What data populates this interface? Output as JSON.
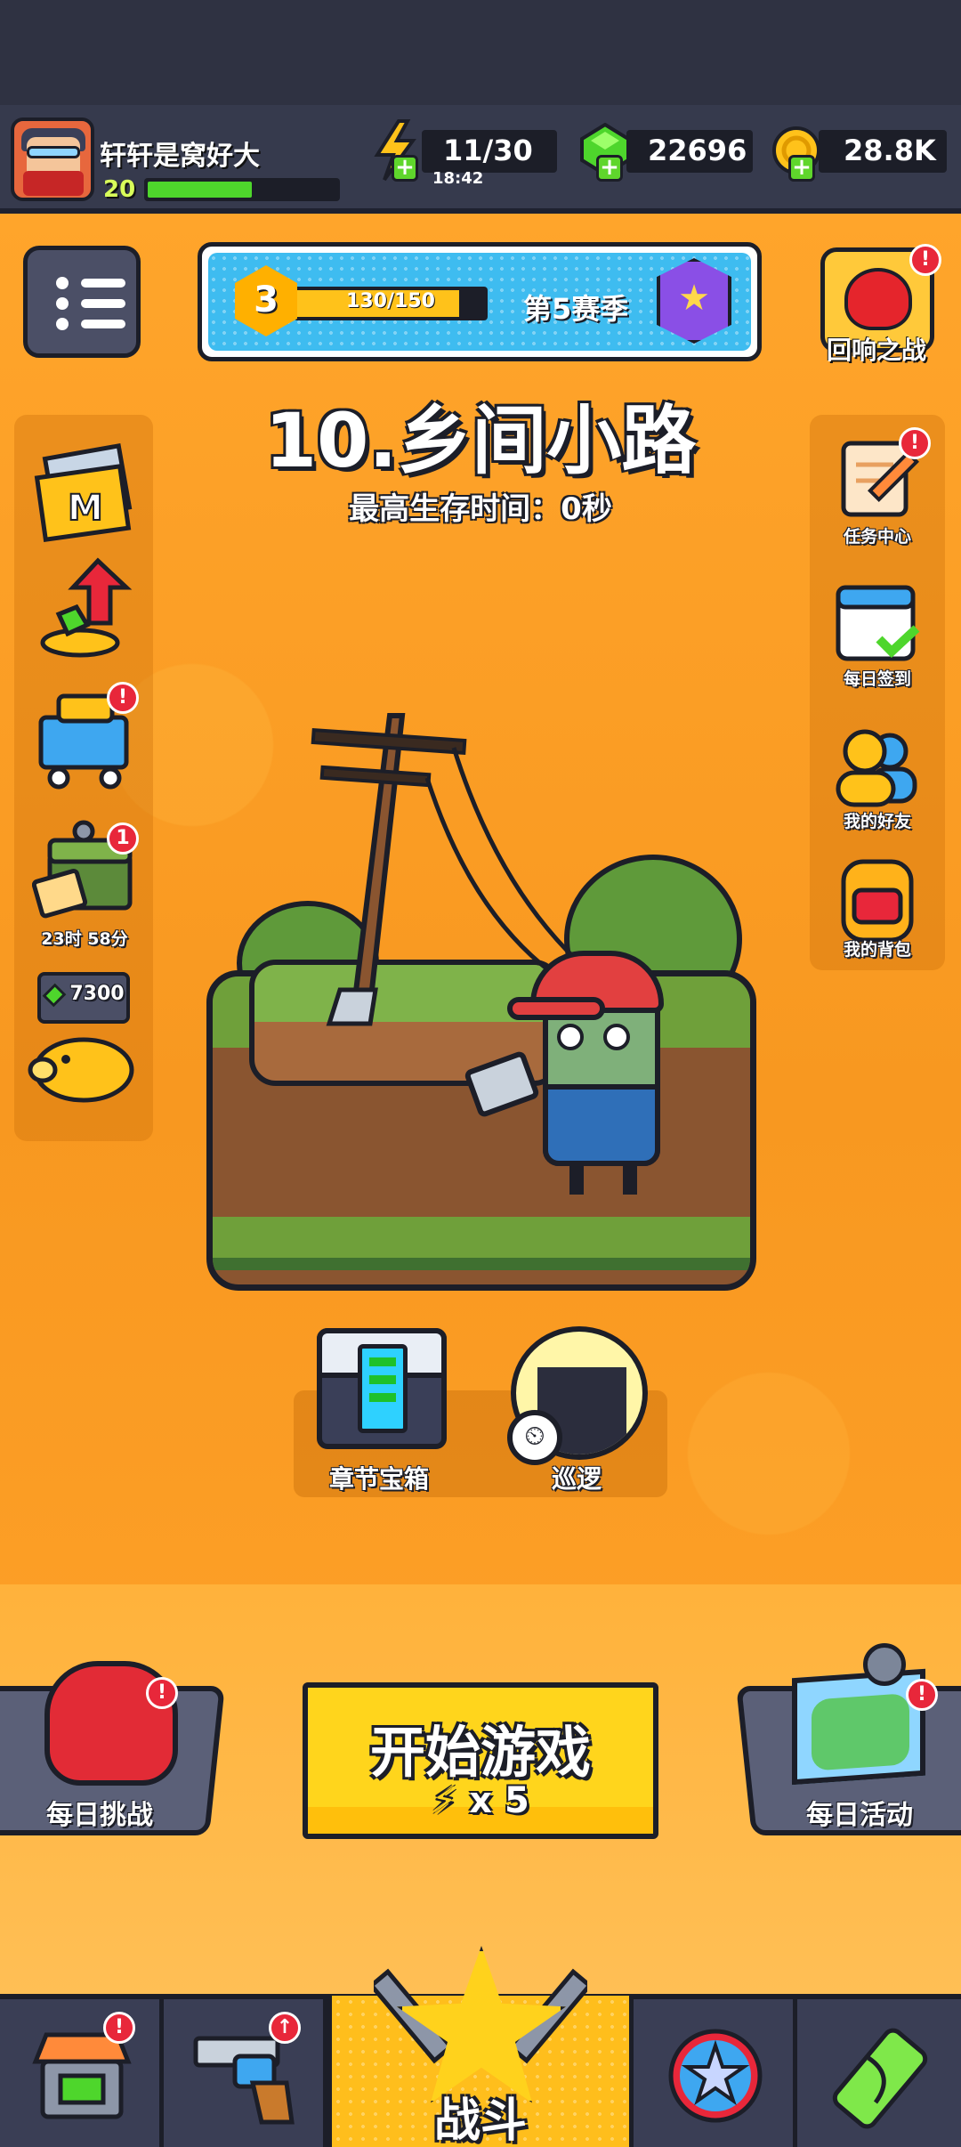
{
  "player": {
    "name": "轩轩是窝好大",
    "level": "20",
    "xp_fraction": 0.55
  },
  "resources": {
    "energy": "11/30",
    "energy_timer": "18:42",
    "gems": "22696",
    "coins": "28.8K"
  },
  "season": {
    "level": "3",
    "progress_text": "130/150",
    "progress_fraction": 0.8667,
    "label": "第5赛季"
  },
  "echo_battle": {
    "label": "回响之战"
  },
  "stage": {
    "title": "10.乡间小路",
    "subtitle": "最高生存时间：0秒"
  },
  "left_panel": {
    "items": [
      {
        "name": "M卡",
        "icon": "m-card-icon"
      },
      {
        "name": "成长",
        "icon": "growth-arrow-icon"
      },
      {
        "name": "商店推车",
        "icon": "shopping-cart-icon",
        "badge": "!"
      },
      {
        "name": "箱子",
        "icon": "crate-icon",
        "badge": "1",
        "timer": "23时 58分"
      },
      {
        "name": "存钱罐",
        "icon": "piggy-bank-icon",
        "value": "7300"
      }
    ]
  },
  "right_panel": {
    "items": [
      {
        "label": "任务中心",
        "icon": "task-scroll-icon",
        "badge": "!"
      },
      {
        "label": "每日签到",
        "icon": "calendar-check-icon"
      },
      {
        "label": "我的好友",
        "icon": "friends-icon"
      },
      {
        "label": "我的背包",
        "icon": "backpack-icon"
      }
    ]
  },
  "actions": {
    "chapter_chest": "章节宝箱",
    "patrol": "巡逻",
    "daily_challenge": "每日挑战",
    "daily_event": "每日活动",
    "start_game": "开始游戏",
    "start_cost": "x 5"
  },
  "bottom_nav": {
    "battle": "战斗",
    "tabs": [
      "shop",
      "weapons",
      "battle",
      "talents",
      "gene"
    ]
  },
  "colors": {
    "background": "#f79a1d",
    "accent_yellow": "#ffd51c",
    "gem_green": "#4ed62c",
    "badge_red": "#e8273a",
    "dark_outline": "#1c1e28"
  }
}
